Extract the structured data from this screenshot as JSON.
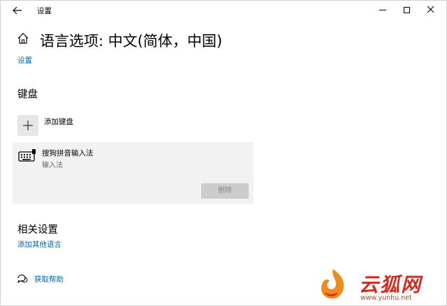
{
  "window": {
    "title": "设置",
    "back_icon": "arrow-left-icon",
    "controls": [
      "minimize",
      "maximize",
      "close"
    ]
  },
  "header": {
    "home_icon": "home-icon",
    "title": "语言选项: 中文(简体，中国)",
    "breadcrumb": "设置"
  },
  "keyboard": {
    "heading": "键盘",
    "add_label": "添加键盘",
    "items": [
      {
        "name": "搜狗拼音输入法",
        "type": "输入法",
        "remove_label": "删除"
      }
    ]
  },
  "related": {
    "heading": "相关设置",
    "add_language_link": "添加其他语言"
  },
  "help": {
    "label": "获取帮助"
  },
  "watermark": {
    "brand": "云狐网",
    "url": "www.yunhu.net"
  },
  "colors": {
    "link": "#0067b8",
    "card_bg": "#f2f2f2",
    "button_disabled_bg": "#cccccc",
    "watermark_red": "#d62a1c"
  }
}
